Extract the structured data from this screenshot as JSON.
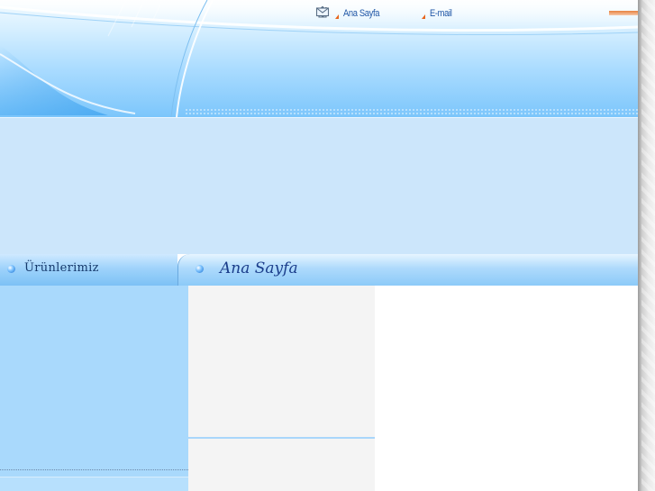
{
  "nav": {
    "home_label": "Ana Sayfa",
    "home_icon": "home-icon",
    "email_label": "E-mail",
    "email_icon": "envelope-icon"
  },
  "sections": {
    "products_title": "Ürünlerimiz",
    "page_title": "Ana Sayfa"
  },
  "colors": {
    "link": "#1f56a6",
    "arrow": "#e8651c",
    "banner": "#cce6fb",
    "sidebar": "#a9d9fc"
  }
}
